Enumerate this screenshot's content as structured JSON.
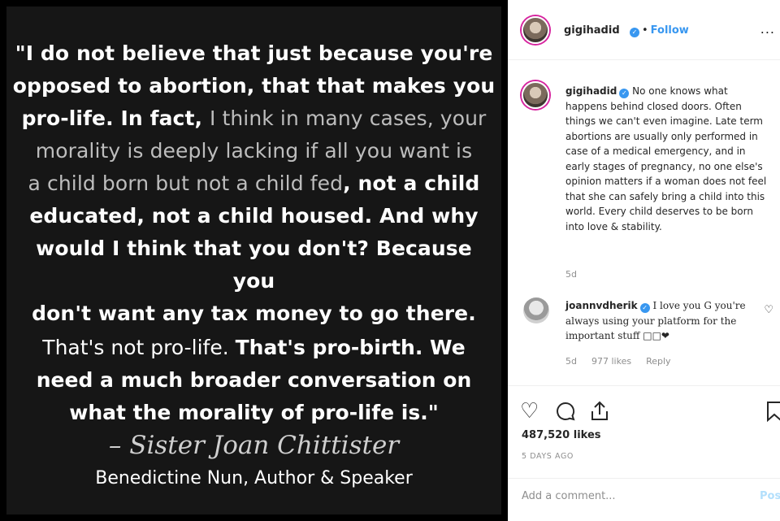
{
  "quote": {
    "line1": "\"I do not believe that just because you're",
    "line2": "opposed to abortion, that that makes you",
    "line3a": "pro-life. In fact, ",
    "line3b": "I think in many cases, your",
    "line4": "morality is deeply lacking if all you want is",
    "line5a": "a child born but not a child fed",
    "line5b": ", not a child",
    "line6": "educated, not a child housed. And why",
    "line7": "would I think that you don't? Because you",
    "line8": "don't want any tax money to go there.",
    "line9a": "That's not pro-life. ",
    "line9b": "That's pro-birth. We",
    "line10": "need a much broader conversation on",
    "line11": "what the morality of pro-life is.\"",
    "author": "– Sister Joan Chittister",
    "role": "Benedictine Nun, Author & Speaker"
  },
  "header": {
    "username": "gigihadid",
    "separator": "•",
    "follow_label": "Follow",
    "more_label": "..."
  },
  "caption": {
    "username": "gigihadid",
    "text": "No one knows what happens behind closed doors. Often things we can't even imagine. Late term abortions are usually only performed in case of a medical emergency, and in early stages of pregnancy, no one else's opinion matters if a woman does not feel that she can safely bring a child into this world. Every child deserves to be born into love & stability.",
    "age": "5d"
  },
  "comment": {
    "username": "joannvdherik",
    "text": "I love you G you're always using your platform for the important stuff □□❤",
    "age": "5d",
    "likes": "977 likes",
    "reply_label": "Reply"
  },
  "post": {
    "likes": "487,520 likes",
    "posted": "5 DAYS AGO",
    "comment_placeholder": "Add a comment...",
    "post_label": "Post"
  },
  "icons": {
    "verified": "verified-badge-icon",
    "heart": "heart-icon",
    "comment": "comment-icon",
    "share": "share-icon",
    "save": "bookmark-icon"
  },
  "colors": {
    "link_blue": "#3897f0",
    "post_disabled": "#b2dffc",
    "muted_text": "#8e8e8e"
  }
}
